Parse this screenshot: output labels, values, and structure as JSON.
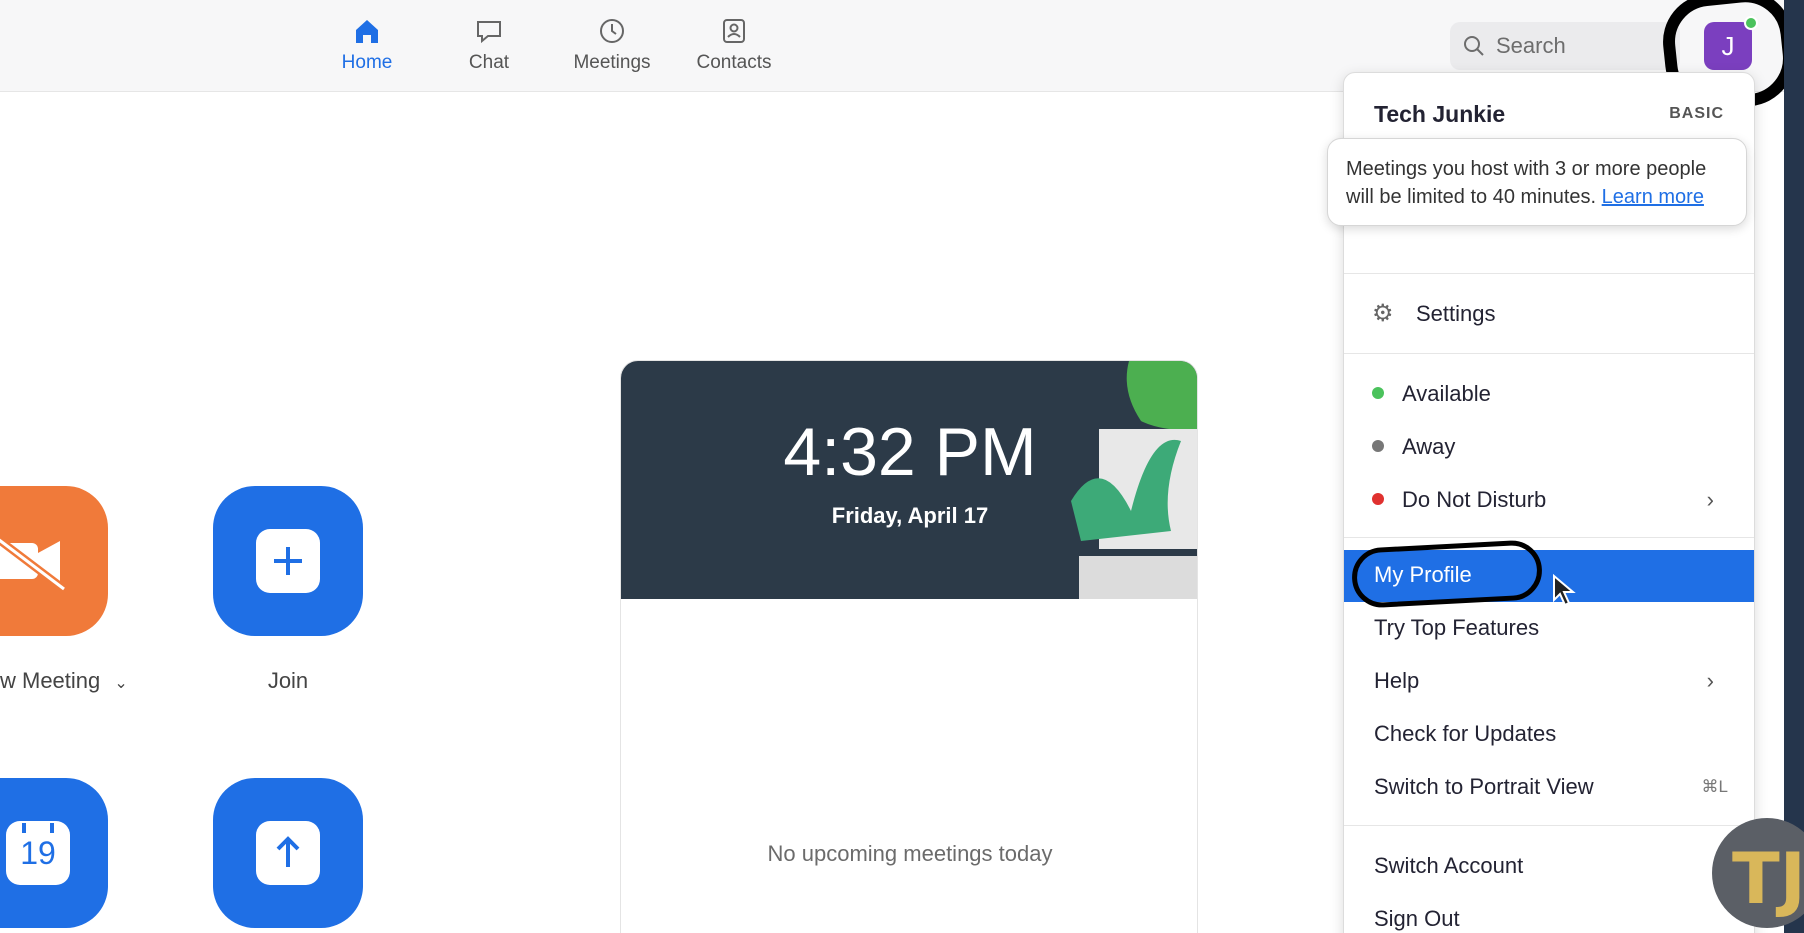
{
  "nav": {
    "tabs": [
      {
        "label": "Home",
        "icon": "home-icon",
        "active": true
      },
      {
        "label": "Chat",
        "icon": "chat-icon",
        "active": false
      },
      {
        "label": "Meetings",
        "icon": "clock-icon",
        "active": false
      },
      {
        "label": "Contacts",
        "icon": "contacts-icon",
        "active": false
      }
    ]
  },
  "search": {
    "placeholder": "Search"
  },
  "user": {
    "initial": "J",
    "name": "Tech Junkie",
    "plan": "BASIC",
    "avatar_color": "#7b3fbf",
    "presence_color": "#4bc25c"
  },
  "actions": {
    "new_meeting_label": "w Meeting",
    "join_label": "Join",
    "schedule_day": "19"
  },
  "card": {
    "time": "4:32 PM",
    "date": "Friday, April 17",
    "empty": "No upcoming meetings today"
  },
  "tooltip": {
    "text": "Meetings you host with 3 or more people will be limited to 40 minutes.",
    "link": "Learn more"
  },
  "menu": {
    "settings": "Settings",
    "status": [
      {
        "label": "Available",
        "color": "#4bc25c"
      },
      {
        "label": "Away",
        "color": "#777777"
      },
      {
        "label": "Do Not Disturb",
        "color": "#e0312f"
      }
    ],
    "items": [
      {
        "label": "My Profile",
        "selected": true
      },
      {
        "label": "Try Top Features"
      },
      {
        "label": "Help"
      },
      {
        "label": "Check for Updates"
      },
      {
        "label": "Switch to Portrait View",
        "shortcut": "⌘L"
      }
    ],
    "account": [
      "Switch Account",
      "Sign Out"
    ]
  },
  "colors": {
    "accent": "#1f6fe5",
    "orange": "#f07a3a",
    "hero": "#2c3a48"
  },
  "watermark": "TJ"
}
